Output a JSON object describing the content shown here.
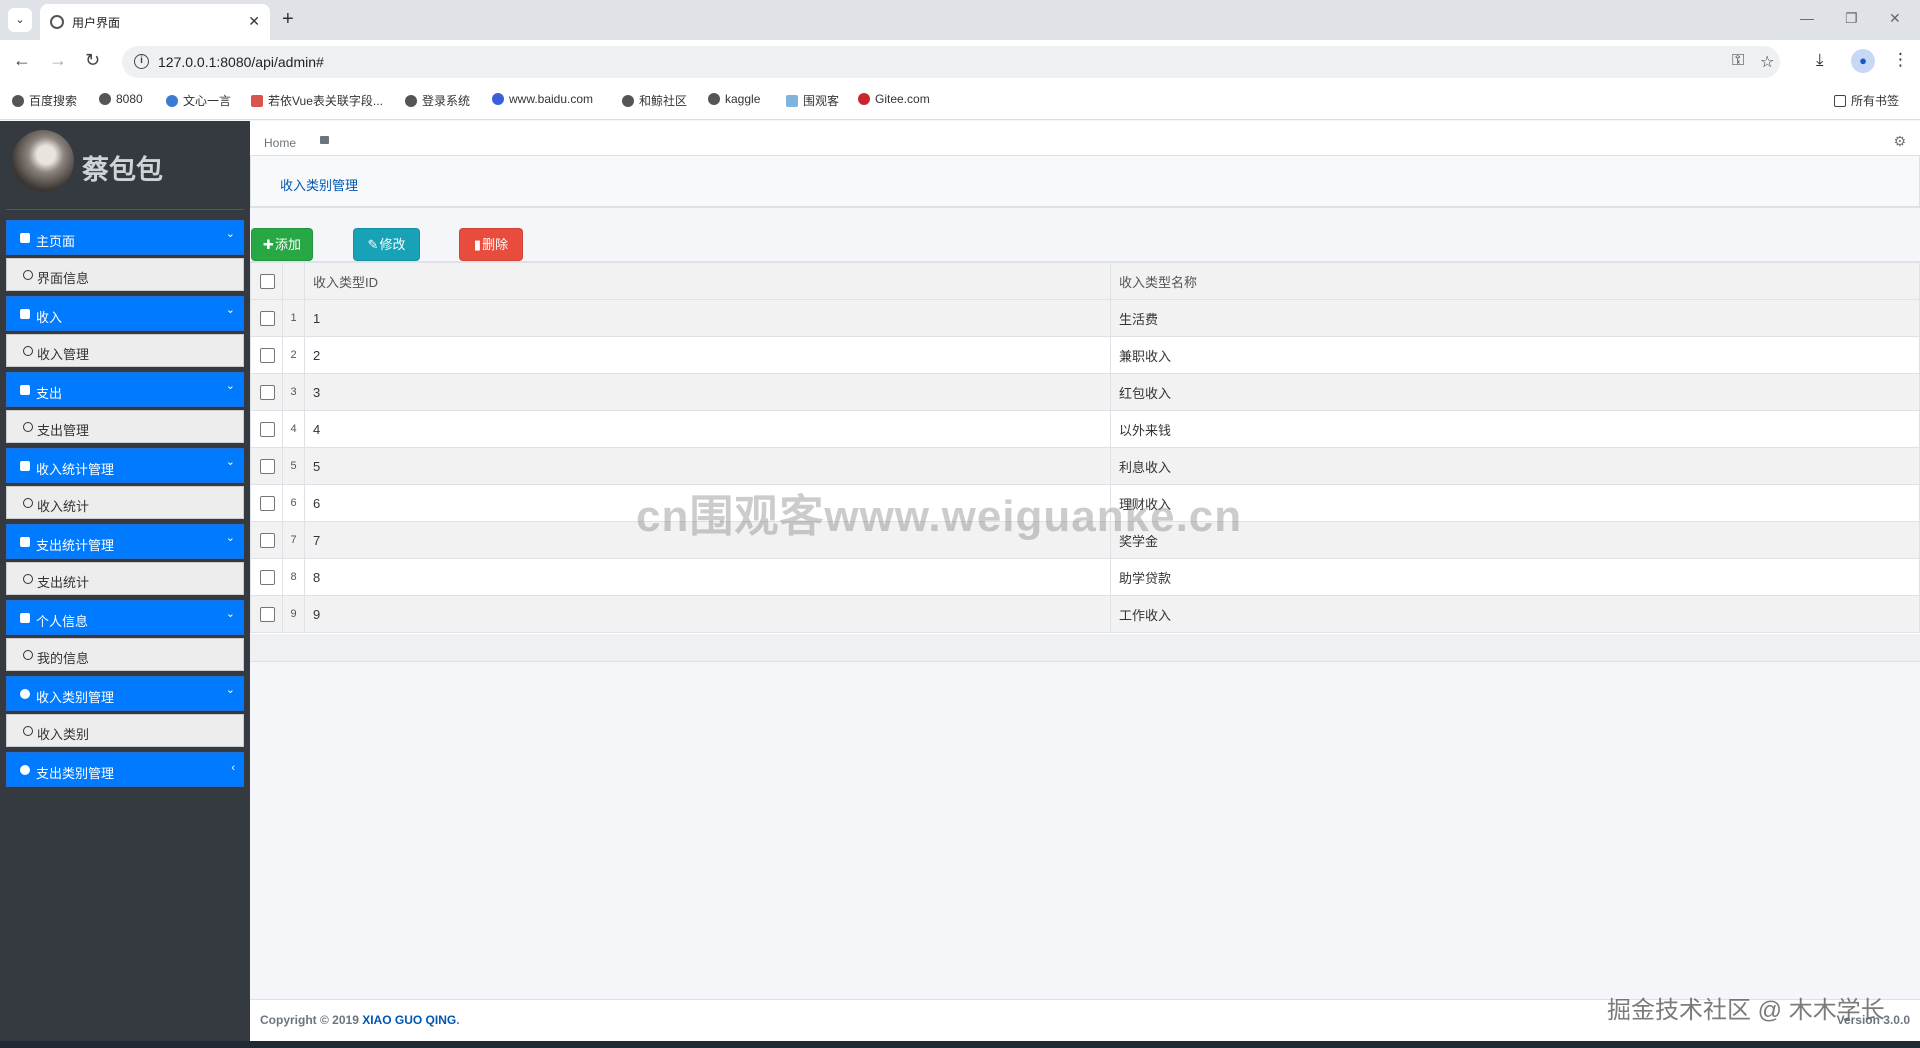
{
  "browser": {
    "tab_title": "用户界面",
    "url": "127.0.0.1:8080/api/admin#",
    "bookmarks": [
      "百度搜索",
      "8080",
      "文心一言",
      "若依Vue表关联字段...",
      "登录系统",
      "www.baidu.com",
      "和鲸社区",
      "kaggle",
      "围观客",
      "Gitee.com"
    ],
    "all_bookmarks": "所有书签"
  },
  "sidebar": {
    "brand": "蔡包包",
    "menu": [
      {
        "label": "主页面",
        "sub": "界面信息"
      },
      {
        "label": "收入",
        "sub": "收入管理"
      },
      {
        "label": "支出",
        "sub": "支出管理"
      },
      {
        "label": "收入统计管理",
        "sub": "收入统计"
      },
      {
        "label": "支出统计管理",
        "sub": "支出统计"
      },
      {
        "label": "个人信息",
        "sub": "我的信息"
      },
      {
        "label": "收入类别管理",
        "sub": "收入类别"
      },
      {
        "label": "支出类别管理"
      }
    ]
  },
  "header": {
    "home": "Home"
  },
  "page": {
    "title": "收入类别管理"
  },
  "buttons": {
    "add": "添加",
    "edit": "修改",
    "delete": "删除"
  },
  "table": {
    "headers": [
      "收入类型ID",
      "收入类型名称"
    ],
    "rows": [
      {
        "n": "1",
        "id": "1",
        "name": "生活费"
      },
      {
        "n": "2",
        "id": "2",
        "name": "兼职收入"
      },
      {
        "n": "3",
        "id": "3",
        "name": "红包收入"
      },
      {
        "n": "4",
        "id": "4",
        "name": "以外来钱"
      },
      {
        "n": "5",
        "id": "5",
        "name": "利息收入"
      },
      {
        "n": "6",
        "id": "6",
        "name": "理财收入"
      },
      {
        "n": "7",
        "id": "7",
        "name": "奖学金"
      },
      {
        "n": "8",
        "id": "8",
        "name": "助学贷款"
      },
      {
        "n": "9",
        "id": "9",
        "name": "工作收入"
      }
    ]
  },
  "footer": {
    "copyright_prefix": "Copyright © 2019 ",
    "author": "XIAO GUO QING",
    "suffix": ".",
    "version": "Version 3.0.0"
  },
  "watermarks": {
    "center": "cn围观客www.weiguanke.cn",
    "corner": "掘金技术社区 @ 木木学长"
  },
  "colors": {
    "primary": "#007bff",
    "success": "#28a745",
    "info": "#17a2b8",
    "danger": "#e74c3c",
    "sidebar": "#343a40"
  }
}
